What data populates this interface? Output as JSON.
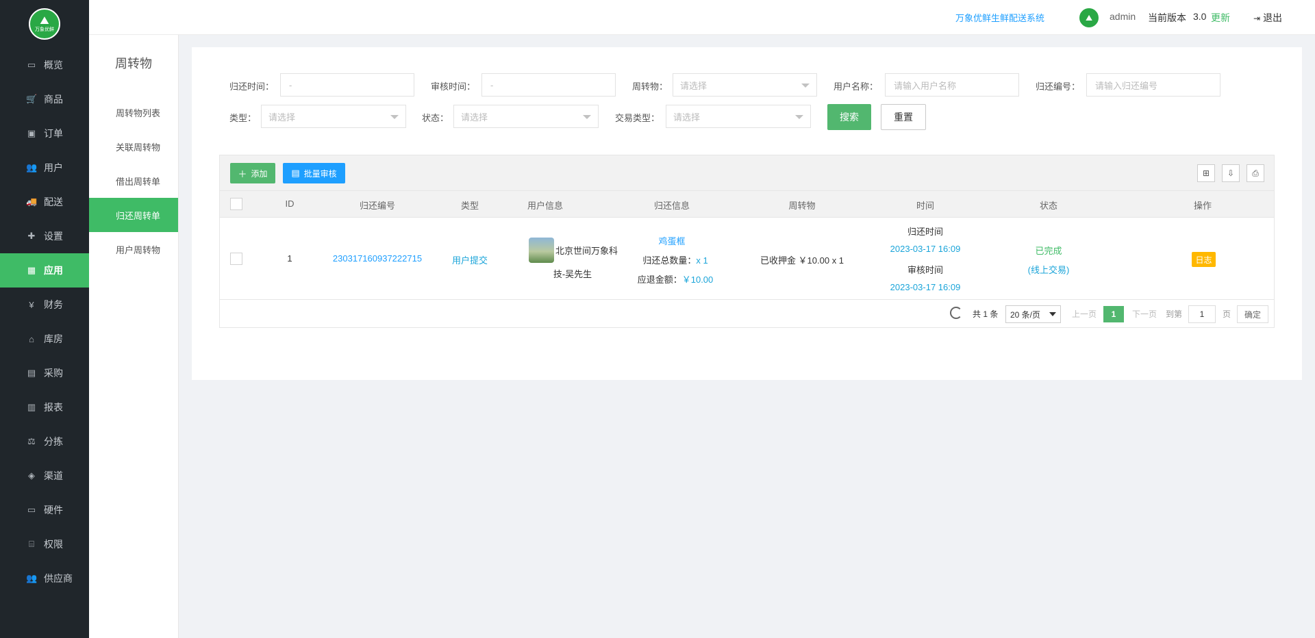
{
  "logo": {
    "glyph": "⛰",
    "text": "万象优鲜"
  },
  "sidebar": {
    "items": [
      {
        "icon": "monitor-icon",
        "glyph": "▭",
        "label": "概览"
      },
      {
        "icon": "cart-icon",
        "glyph": "🛒",
        "label": "商品"
      },
      {
        "icon": "money-icon",
        "glyph": "▣",
        "label": "订单"
      },
      {
        "icon": "users-icon",
        "glyph": "👥",
        "label": "用户"
      },
      {
        "icon": "truck-icon",
        "glyph": "🚚",
        "label": "配送"
      },
      {
        "icon": "puzzle-icon",
        "glyph": "✚",
        "label": "设置"
      },
      {
        "icon": "apps-icon",
        "glyph": "▦",
        "label": "应用"
      },
      {
        "icon": "yen-icon",
        "glyph": "¥",
        "label": "财务"
      },
      {
        "icon": "home-icon",
        "glyph": "⌂",
        "label": "库房"
      },
      {
        "icon": "bus-icon",
        "glyph": "▤",
        "label": "采购"
      },
      {
        "icon": "bar-chart-icon",
        "glyph": "▥",
        "label": "报表"
      },
      {
        "icon": "scale-icon",
        "glyph": "⚖",
        "label": "分拣"
      },
      {
        "icon": "cube-icon",
        "glyph": "◈",
        "label": "渠道"
      },
      {
        "icon": "desktop-icon",
        "glyph": "▭",
        "label": "硬件"
      },
      {
        "icon": "bank-icon",
        "glyph": "⌸",
        "label": "权限"
      },
      {
        "icon": "supplier-icon",
        "glyph": "👥",
        "label": "供应商"
      }
    ],
    "active_index": 6
  },
  "subside": {
    "title": "周转物",
    "items": [
      "周转物列表",
      "关联周转物",
      "借出周转单",
      "归还周转单",
      "用户周转物"
    ],
    "active_index": 3
  },
  "header": {
    "system_name": "万象优鲜生鲜配送系统",
    "avatar_text": "⛰",
    "user": "admin",
    "version_label": "当前版本",
    "version": "3.0",
    "update": "更新",
    "logout": "退出"
  },
  "filters": {
    "return_time": {
      "label": "归还时间：",
      "value": "-"
    },
    "audit_time": {
      "label": "审核时间：",
      "value": "-"
    },
    "item": {
      "label": "周转物：",
      "placeholder": "请选择"
    },
    "user_name": {
      "label": "用户名称：",
      "placeholder": "请输入用户名称"
    },
    "return_no": {
      "label": "归还编号：",
      "placeholder": "请输入归还编号"
    },
    "type": {
      "label": "类型：",
      "placeholder": "请选择"
    },
    "status": {
      "label": "状态：",
      "placeholder": "请选择"
    },
    "trade_type": {
      "label": "交易类型：",
      "placeholder": "请选择"
    },
    "search": "搜索",
    "reset": "重置"
  },
  "toolbar": {
    "add": "添加",
    "batch_audit": "批量审核"
  },
  "table": {
    "columns": [
      "ID",
      "归还编号",
      "类型",
      "用户信息",
      "归还信息",
      "周转物",
      "时间",
      "状态",
      "操作"
    ],
    "rows": [
      {
        "id": "1",
        "return_no": "230317160937222715",
        "type": "用户提交",
        "user_line1": "北京世间万象科",
        "user_line2": "技-吴先生",
        "item_name": "鸡蛋框",
        "qty_label": "归还总数量：",
        "qty_value": "x 1",
        "refund_label": "应退金额：",
        "refund_value": "￥10.00",
        "deposit": "已收押金 ￥10.00 x 1",
        "return_time_label": "归还时间",
        "return_time": "2023-03-17 16:09",
        "audit_time_label": "审核时间",
        "audit_time": "2023-03-17 16:09",
        "status": "已完成",
        "trade": "(线上交易)",
        "action": "日志"
      }
    ]
  },
  "pager": {
    "total": "共 1 条",
    "page_size": "20 条/页",
    "prev": "上一页",
    "current": "1",
    "next": "下一页",
    "goto_label": "到第",
    "goto_value": "1",
    "unit": "页",
    "confirm": "确定"
  }
}
